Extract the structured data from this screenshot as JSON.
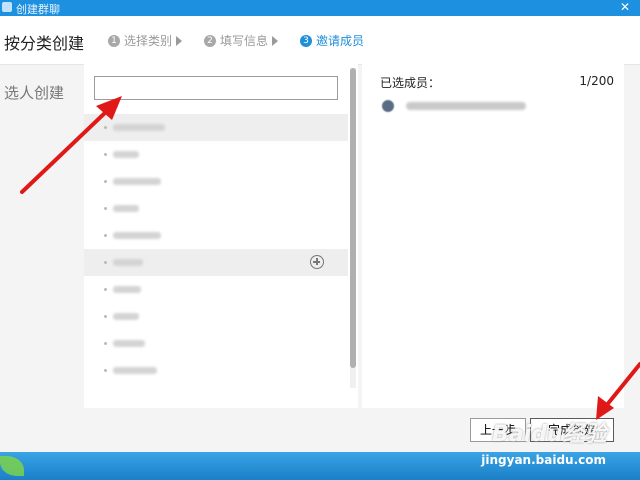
{
  "window": {
    "title": "创建群聊"
  },
  "header": {
    "category_label": "按分类创建",
    "steps": [
      {
        "num": "1",
        "label": "选择类别"
      },
      {
        "num": "2",
        "label": "填写信息"
      },
      {
        "num": "3",
        "label": "邀请成员"
      }
    ]
  },
  "left": {
    "mode_label": "选人创建",
    "search_placeholder": ""
  },
  "right": {
    "selected_label": "已选成员：",
    "count": "1/200"
  },
  "footer": {
    "prev_label": "上一步",
    "done_label": "完成创建"
  },
  "watermark": {
    "site": "jingyan.baidu.com",
    "brand": "Baidu经验"
  },
  "colors": {
    "accent": "#1e8fd8",
    "arrow": "#e01818"
  }
}
